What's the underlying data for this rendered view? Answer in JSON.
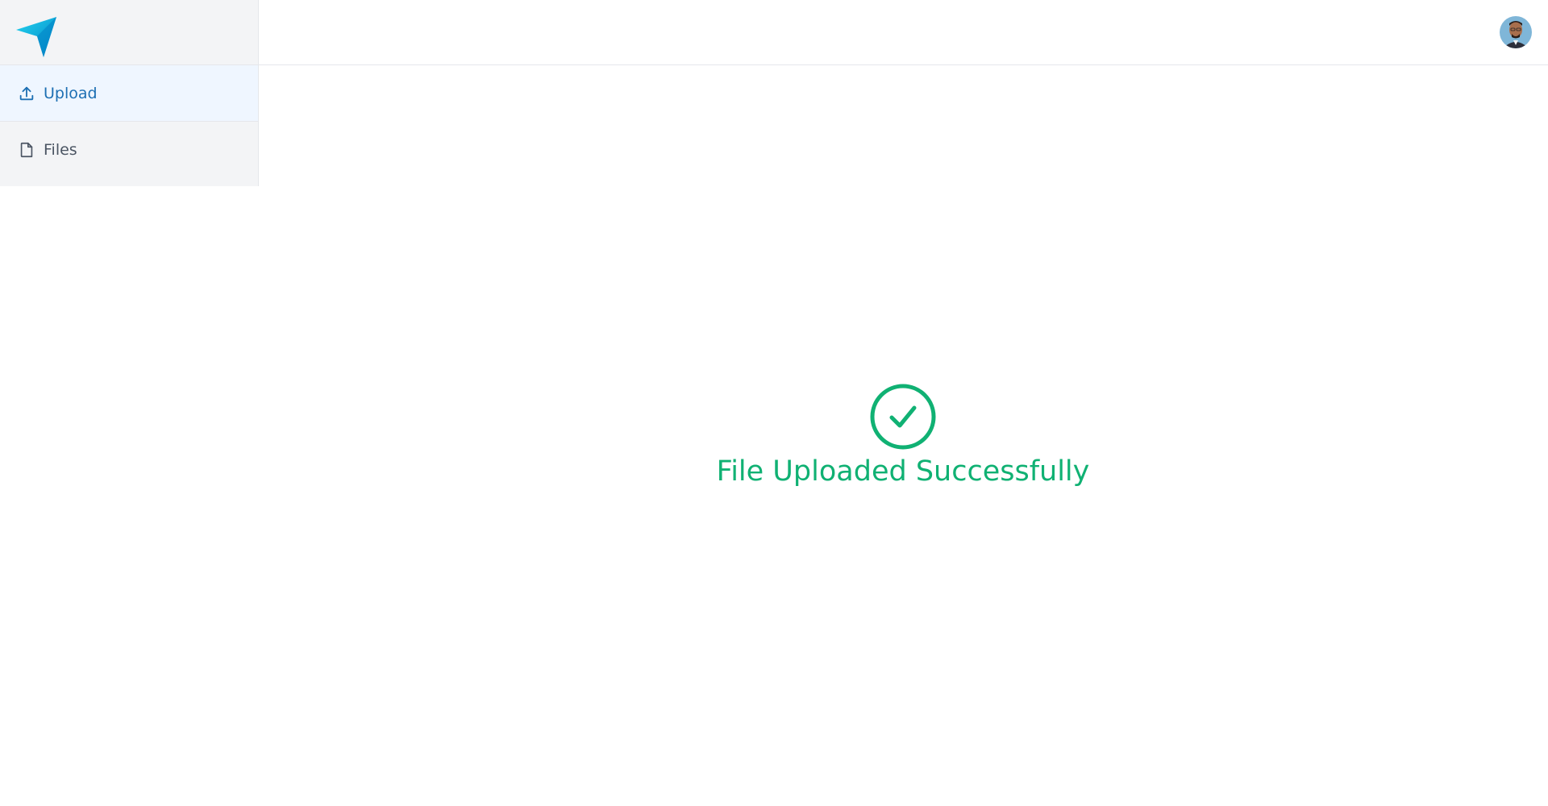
{
  "brand": {
    "logo_icon": "paper-plane-icon",
    "color": "#0ea5e9"
  },
  "sidebar": {
    "items": [
      {
        "label": "Upload",
        "icon": "upload-icon",
        "active": true
      },
      {
        "label": "Files",
        "icon": "file-icon",
        "active": false
      }
    ]
  },
  "header": {
    "avatar_icon": "user-avatar"
  },
  "main": {
    "status_icon": "check-circle-icon",
    "status_text": "File Uploaded Successfully",
    "status_color": "#10b173"
  }
}
